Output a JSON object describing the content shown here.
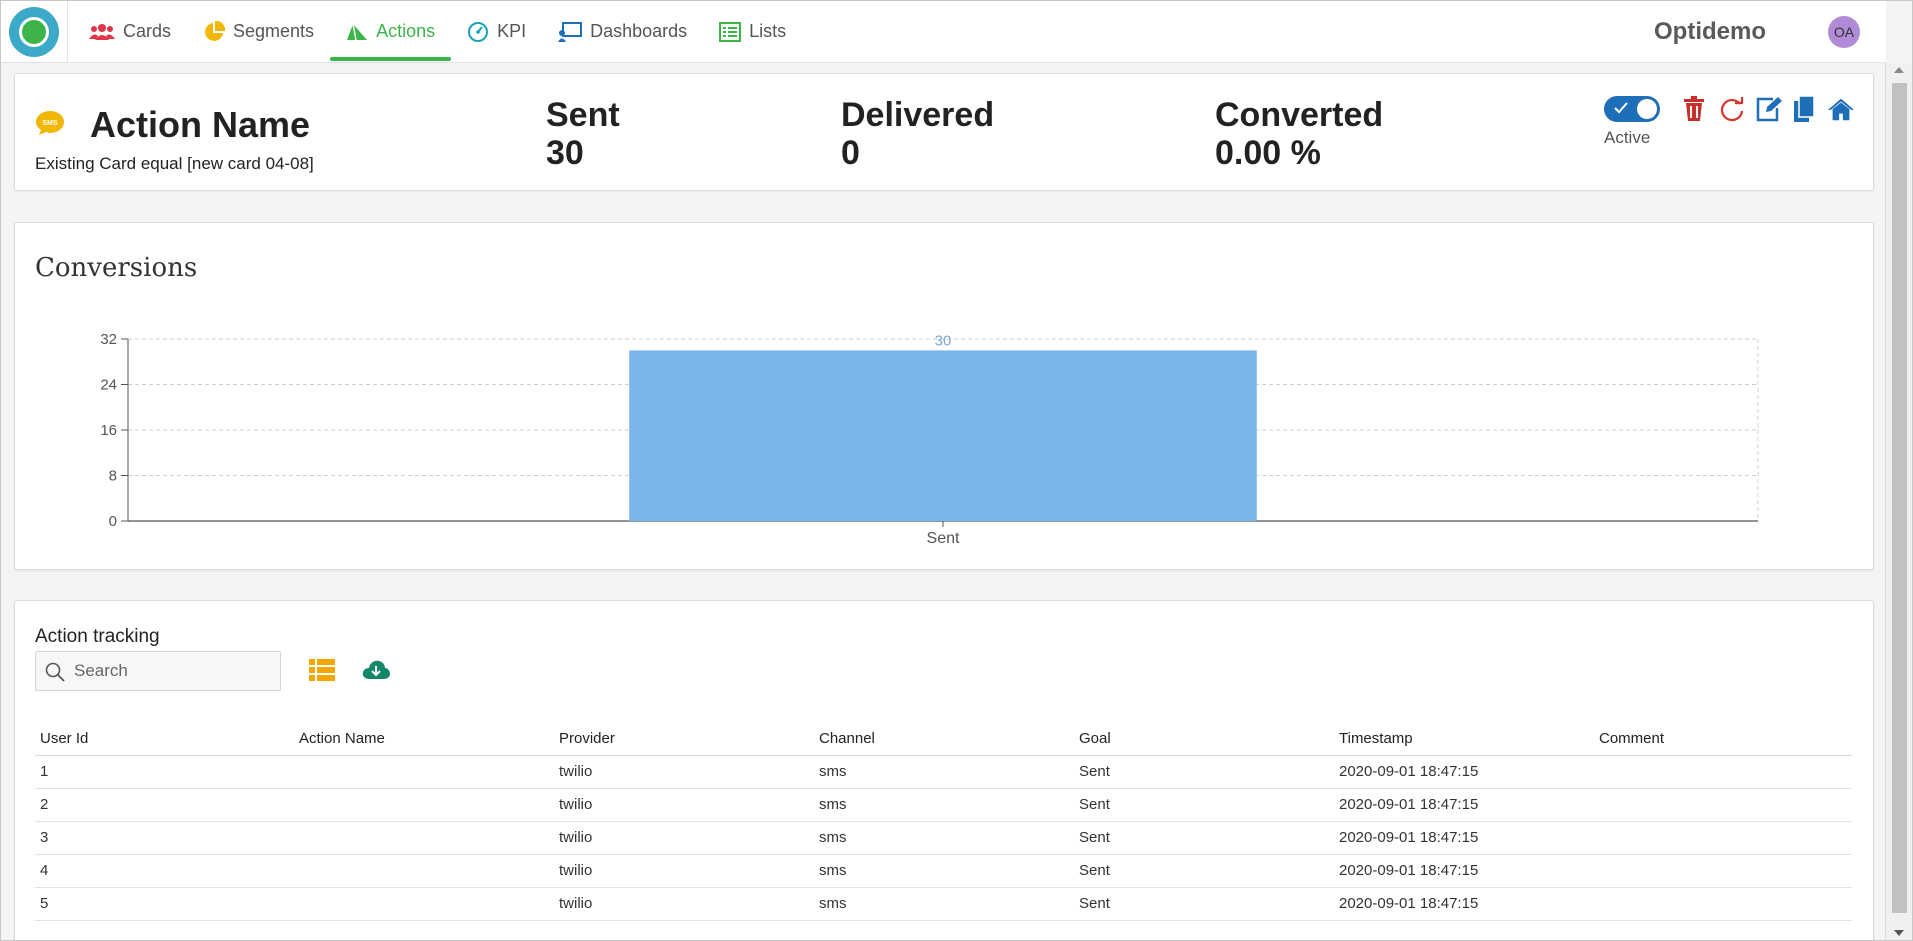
{
  "app": {
    "brand": "Optidemo",
    "avatar_initials": "OA"
  },
  "nav": {
    "tabs": [
      {
        "label": "Cards",
        "icon": "users-icon",
        "color": "#e0344a"
      },
      {
        "label": "Segments",
        "icon": "pie-chart-icon",
        "color": "#f2b705"
      },
      {
        "label": "Actions",
        "icon": "send-icon",
        "color": "#3bb54a",
        "active": true
      },
      {
        "label": "KPI",
        "icon": "speedometer-icon",
        "color": "#17a2b8"
      },
      {
        "label": "Dashboards",
        "icon": "presentation-icon",
        "color": "#1e6fb8"
      },
      {
        "label": "Lists",
        "icon": "list-icon",
        "color": "#3bb54a"
      }
    ]
  },
  "action": {
    "title": "Action Name",
    "subtitle": "Existing Card equal [new card 04-08]",
    "channel_icon_text": "SMS",
    "stats": {
      "sent_label": "Sent",
      "sent_value": "30",
      "delivered_label": "Delivered",
      "delivered_value": "0",
      "converted_label": "Converted",
      "converted_value": "0.00 %"
    },
    "status_label": "Active",
    "status_active": true,
    "toolbar_icons": [
      "trash-icon",
      "refresh-icon",
      "edit-icon",
      "copy-icon",
      "home-icon"
    ]
  },
  "chart": {
    "title": "Conversions"
  },
  "chart_data": {
    "type": "bar",
    "categories": [
      "Sent"
    ],
    "values": [
      30
    ],
    "data_labels": [
      "30"
    ],
    "title": "Conversions",
    "xlabel": "",
    "ylabel": "",
    "ylim": [
      0,
      32
    ],
    "yticks": [
      0,
      8,
      16,
      24,
      32
    ],
    "grid": true,
    "bar_color": "#7cb5ec",
    "label_color": "#7aa7d9"
  },
  "tracking": {
    "title": "Action tracking",
    "search_placeholder": "Search",
    "columns": [
      "User Id",
      "Action Name",
      "Provider",
      "Channel",
      "Goal",
      "Timestamp",
      "Comment"
    ],
    "rows": [
      [
        "1",
        "",
        "twilio",
        "sms",
        "Sent",
        "2020-09-01 18:47:15",
        ""
      ],
      [
        "2",
        "",
        "twilio",
        "sms",
        "Sent",
        "2020-09-01 18:47:15",
        ""
      ],
      [
        "3",
        "",
        "twilio",
        "sms",
        "Sent",
        "2020-09-01 18:47:15",
        ""
      ],
      [
        "4",
        "",
        "twilio",
        "sms",
        "Sent",
        "2020-09-01 18:47:15",
        ""
      ],
      [
        "5",
        "",
        "twilio",
        "sms",
        "Sent",
        "2020-09-01 18:47:15",
        ""
      ]
    ]
  }
}
